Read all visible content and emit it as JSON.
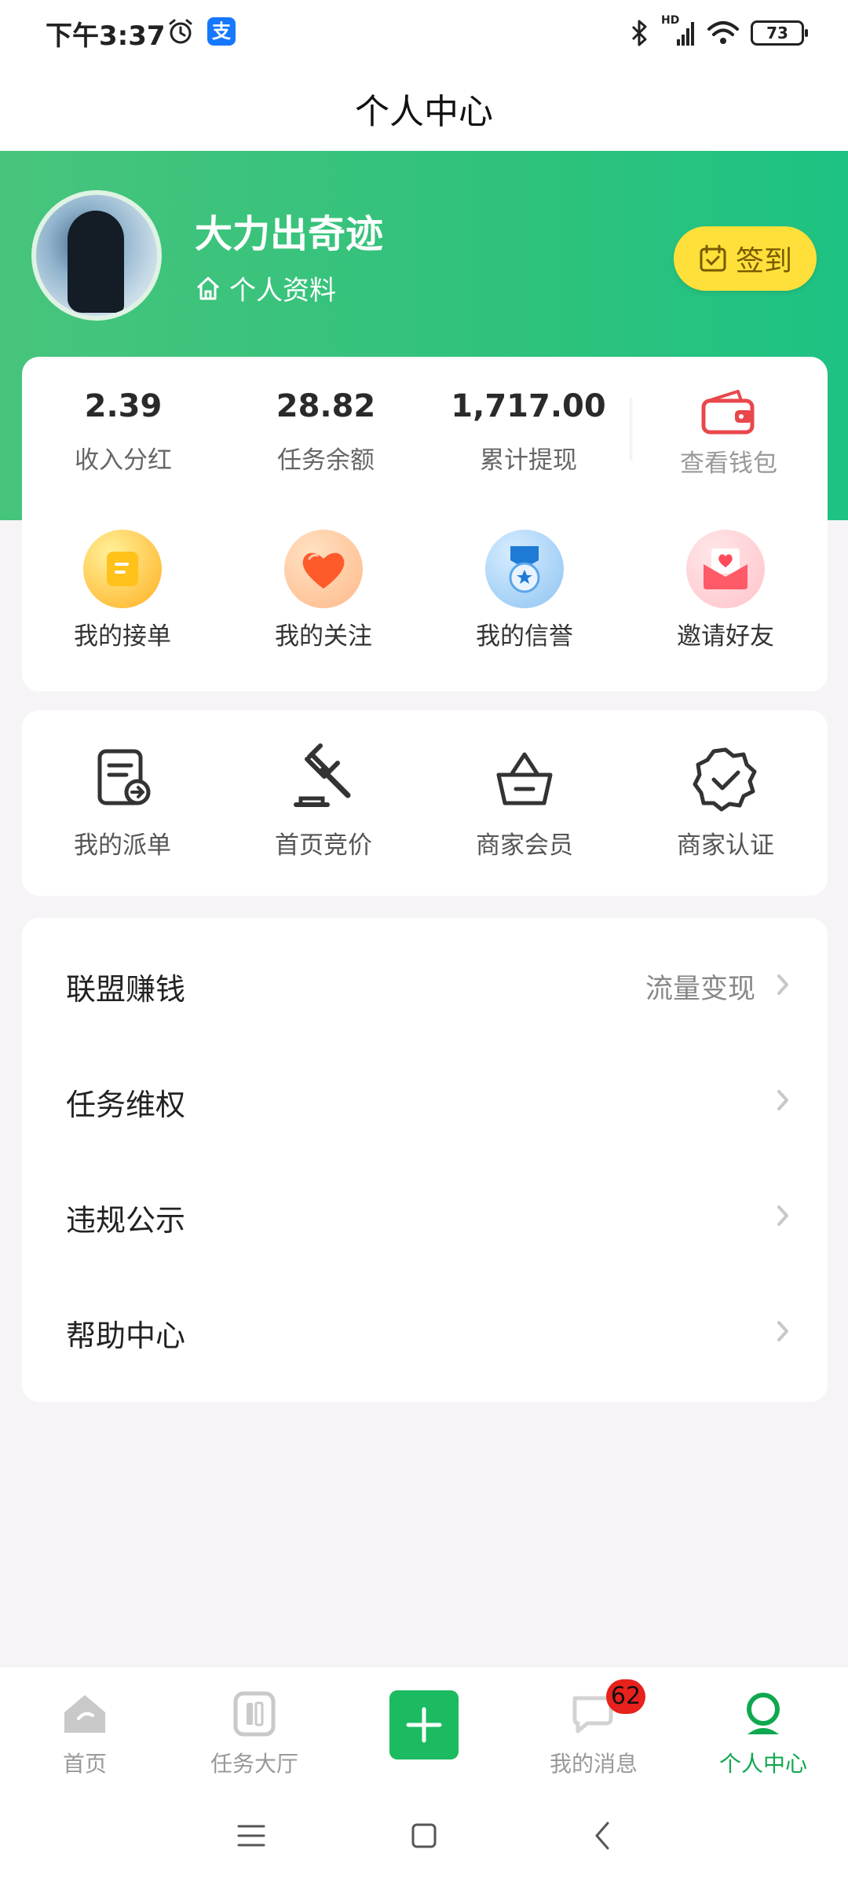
{
  "status_bar": {
    "time": "下午3:37",
    "alipay_glyph": "支",
    "battery": "73",
    "hd_label": "HD",
    "icons": [
      "alarm-icon",
      "alipay-icon",
      "bluetooth-icon",
      "signal-icon",
      "wifi-icon",
      "battery-icon"
    ]
  },
  "header": {
    "title": "个人中心"
  },
  "profile": {
    "username": "大力出奇迹",
    "profile_link": "个人资料",
    "signin_label": "签到"
  },
  "stats": [
    {
      "value": "2.39",
      "label": "收入分红"
    },
    {
      "value": "28.82",
      "label": "任务余额"
    },
    {
      "value": "1,717.00",
      "label": "累计提现"
    }
  ],
  "wallet": {
    "label": "查看钱包"
  },
  "quick_actions": [
    {
      "label": "我的接单",
      "icon": "task-note-icon"
    },
    {
      "label": "我的关注",
      "icon": "heart-icon"
    },
    {
      "label": "我的信誉",
      "icon": "medal-icon"
    },
    {
      "label": "邀请好友",
      "icon": "envelope-heart-icon"
    }
  ],
  "tools": [
    {
      "label": "我的派单",
      "icon": "dispatch-doc-icon"
    },
    {
      "label": "首页竞价",
      "icon": "gavel-icon"
    },
    {
      "label": "商家会员",
      "icon": "crown-basket-icon"
    },
    {
      "label": "商家认证",
      "icon": "verified-badge-icon"
    }
  ],
  "menu": [
    {
      "label": "联盟赚钱",
      "extra": "流量变现"
    },
    {
      "label": "任务维权",
      "extra": ""
    },
    {
      "label": "违规公示",
      "extra": ""
    },
    {
      "label": "帮助中心",
      "extra": ""
    }
  ],
  "tabbar": {
    "items": [
      {
        "label": "首页",
        "icon": "home-icon"
      },
      {
        "label": "任务大厅",
        "icon": "task-hall-icon"
      },
      {
        "label": "我的消息",
        "icon": "message-icon"
      },
      {
        "label": "个人中心",
        "icon": "profile-icon"
      }
    ],
    "message_badge": "62",
    "publish_icon": "plus-icon"
  },
  "colors": {
    "accent_green": "#1ec283",
    "signin_yellow": "#ffe03a",
    "active_tab": "#0fa84f",
    "badge_red": "#e8211c"
  }
}
